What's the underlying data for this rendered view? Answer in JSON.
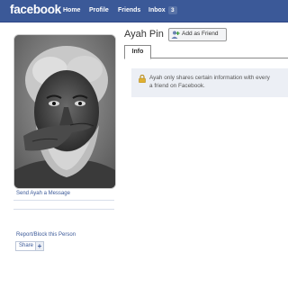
{
  "topbar": {
    "logo": "facebook",
    "nav": {
      "home": "Home",
      "profile": "Profile",
      "friends": "Friends",
      "inbox": "Inbox"
    },
    "inbox_count": "3"
  },
  "profile": {
    "name": "Ayah Pin",
    "add_friend_label": "Add as Friend",
    "tab_info": "Info",
    "privacy_notice_line1": "Ayah only shares certain information with every",
    "privacy_notice_line2": "a friend on Facebook."
  },
  "left": {
    "send_message": "Send Ayah a Message",
    "report_block": "Report/Block this Person",
    "share_label": "Share",
    "share_plus": "+"
  },
  "colors": {
    "brand": "#3b5998",
    "link": "#3b5998",
    "notice_bg": "#eceff5"
  },
  "icons": [
    "add-friend-icon",
    "lock-icon",
    "share-plus-icon"
  ]
}
